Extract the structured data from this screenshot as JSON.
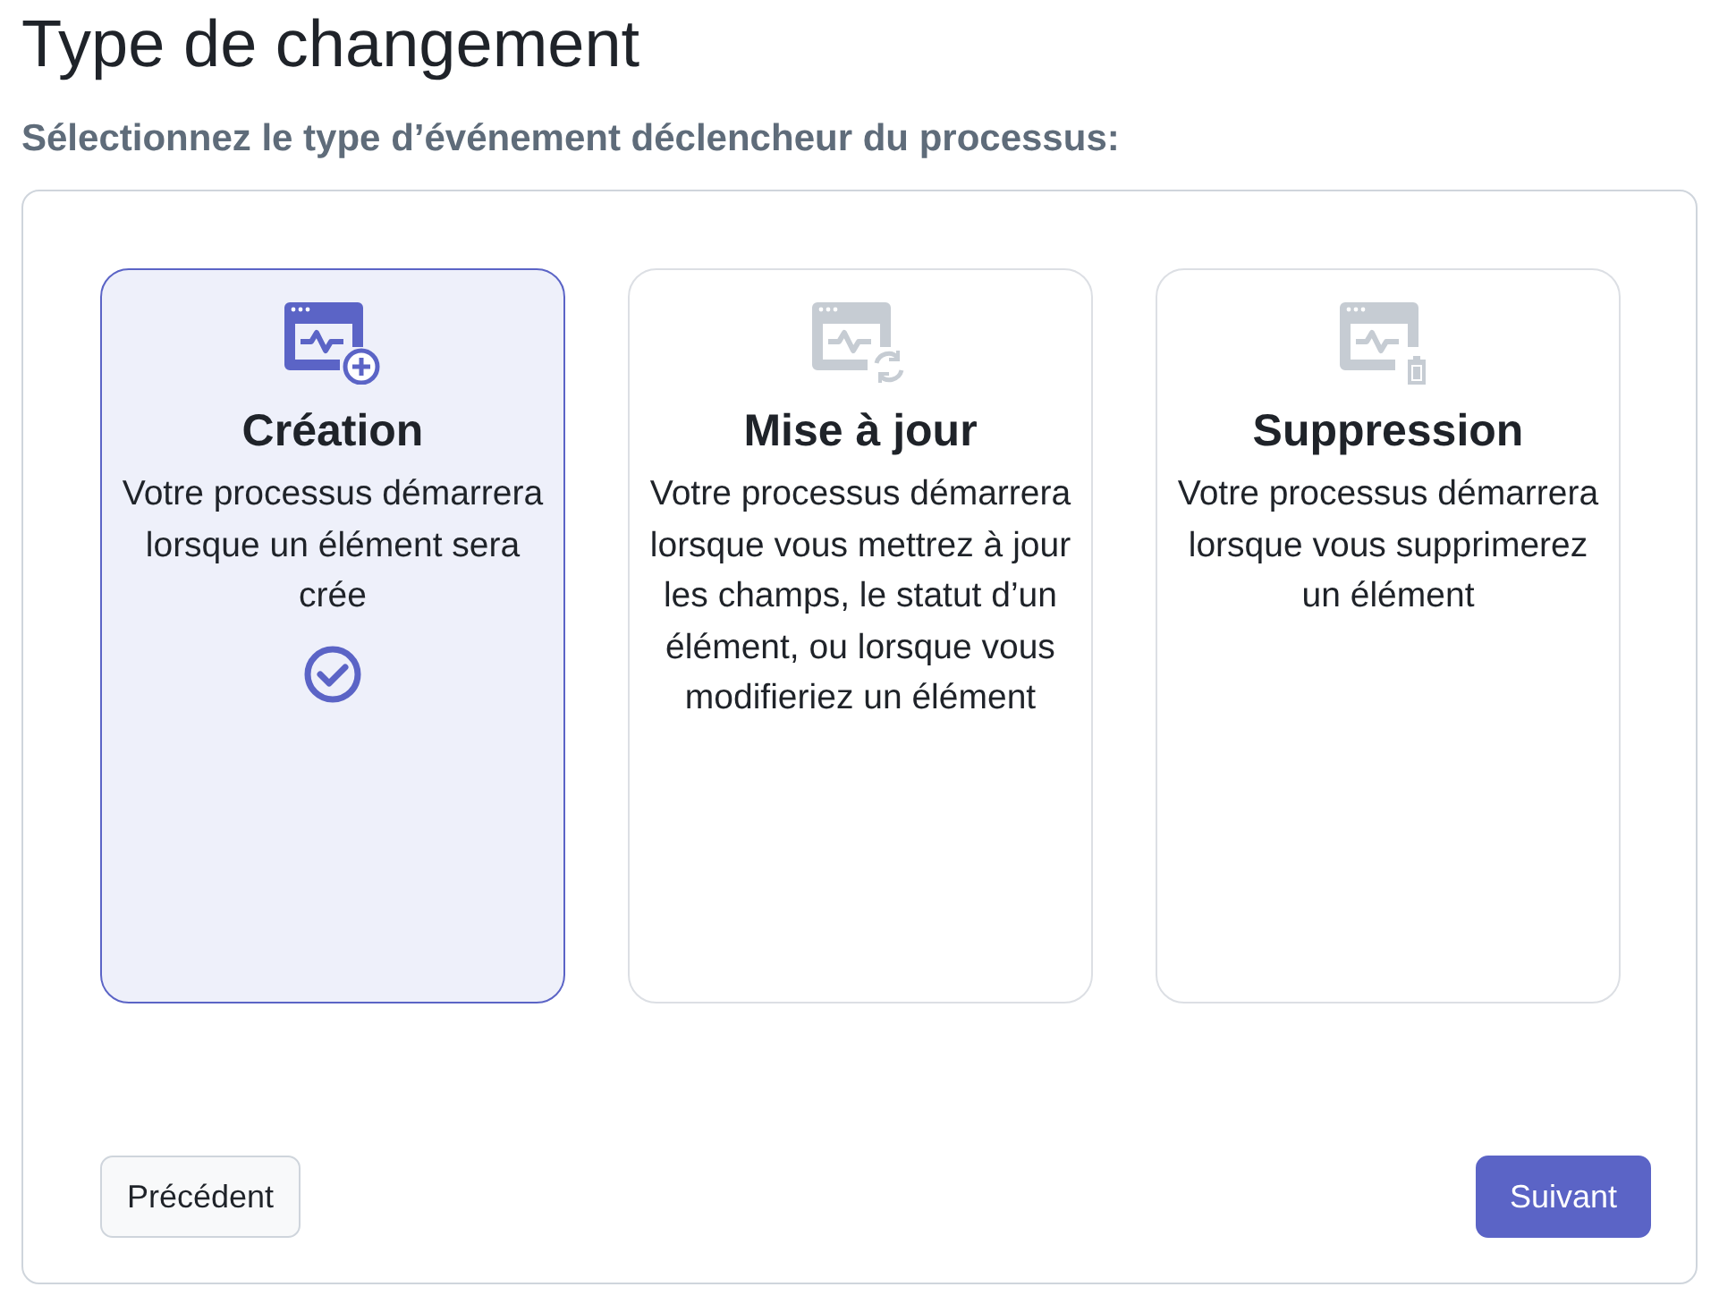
{
  "title": "Type de changement",
  "subtitle": "Sélectionnez le type d’événement déclencheur du processus:",
  "cards": [
    {
      "kind": "create",
      "title": "Création",
      "description": "Votre processus démarrera lorsque un élément sera crée",
      "selected": true
    },
    {
      "kind": "update",
      "title": "Mise à jour",
      "description": "Votre processus démarrera lorsque vous mettrez à jour les champs, le statut d’un élément, ou lorsque vous modifieriez un élément",
      "selected": false
    },
    {
      "kind": "delete",
      "title": "Suppression",
      "description": "Votre processus démarrera lorsque vous supprimerez un élément",
      "selected": false
    }
  ],
  "buttons": {
    "previous": "Précédent",
    "next": "Suivant"
  }
}
